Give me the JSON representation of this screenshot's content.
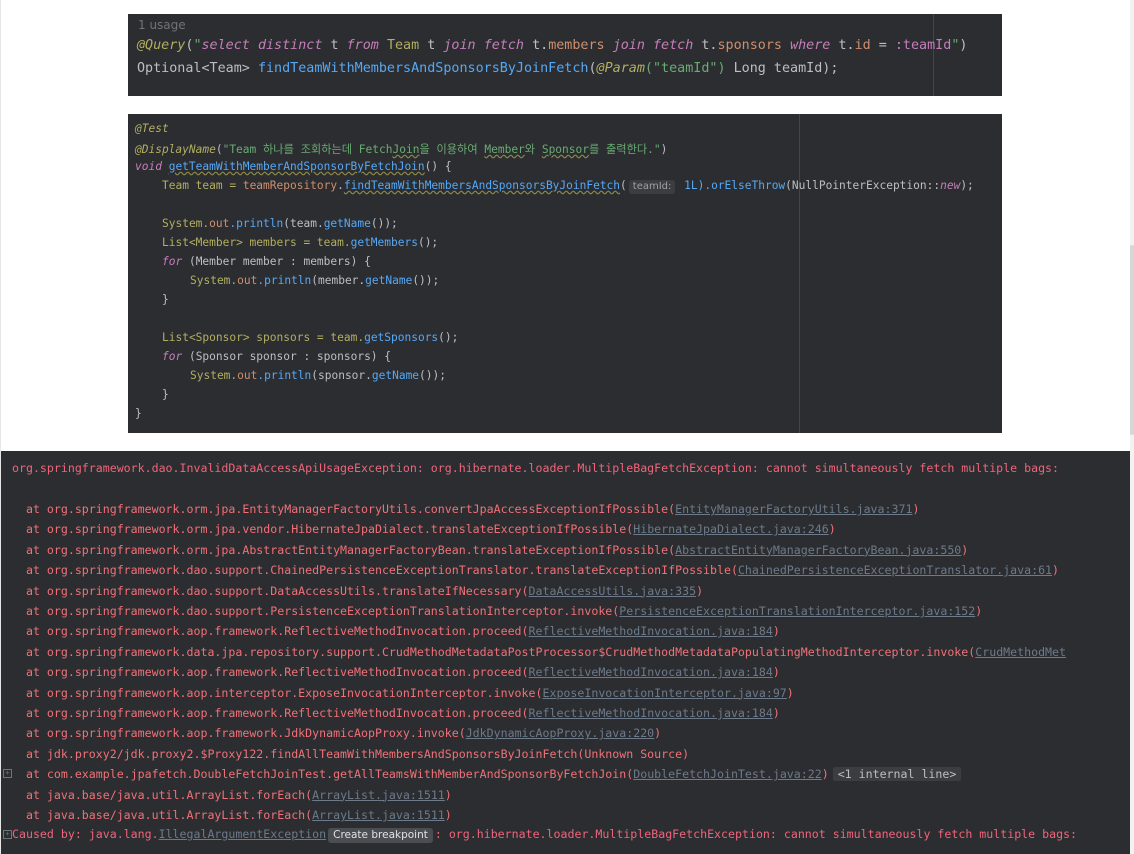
{
  "query_panel": {
    "usage": "1 usage",
    "line1": {
      "annotation": "@Query",
      "open": "(",
      "q_open": "\"",
      "q_select": "select",
      "q_distinct": "distinct",
      "q_t1": "t",
      "q_from": "from",
      "q_team": "Team",
      "q_t2": "t",
      "q_join1": "join",
      "q_fetch1": "fetch",
      "q_t3": "t.",
      "q_members": "members",
      "q_join2": "join",
      "q_fetch2": "fetch",
      "q_t4": "t.",
      "q_sponsors": "sponsors",
      "q_where": "where",
      "q_t5": "t.",
      "q_id": "id",
      "q_eq": "=",
      "q_param": ":teamId",
      "q_close": "\"",
      "close": ")"
    },
    "line2": {
      "type": "Optional<Team>",
      "method": "findTeamWithMembersAndSponsorsByJoinFetch",
      "open": "(",
      "param_ann": "@Param",
      "param_str": "(\"teamId\")",
      "param_type": "Long",
      "param_name": "teamId",
      "close": ");"
    }
  },
  "test_panel": {
    "l1": "@Test",
    "l2_ann": "@DisplayName",
    "l2_open": "(",
    "l2_str_a": "\"Team 하나를 조회하는데 Fetch",
    "l2_str_b": "Join",
    "l2_str_c": "을 이용하여 ",
    "l2_str_d": "Member",
    "l2_str_e": "와 ",
    "l2_str_f": "Sponsor",
    "l2_str_g": "를 출력한다.\"",
    "l2_close": ")",
    "l3_kw": "void",
    "l3_name": "getTeamWithMemberAndSponsorByFetchJoin",
    "l3_rest": "() {",
    "l4_type": "Team team = ",
    "l4_repo": "teamRepository",
    "l4_dot": ".",
    "l4_method": "findTeamWithMembersAndSponsorsByJoinFetch",
    "l4_open": "(",
    "l4_hint": "teamId:",
    "l4_arg": " 1L).",
    "l4_or": "orElseThrow",
    "l4_npe": "(NullPointerException::",
    "l4_new": "new",
    "l4_end": ");",
    "l6_sys": "System.",
    "l6_out": "out",
    "l6_print": ".println",
    "l6_arg": "(team.",
    "l6_get": "getName",
    "l6_end": "());",
    "l7_type": "List<Member> members = team.",
    "l7_get": "getMembers",
    "l7_end": "();",
    "l8_for": "for",
    "l8_rest": " (Member member : members) {",
    "l9_sys": "System.",
    "l9_out": "out",
    "l9_print": ".println",
    "l9_arg": "(member.",
    "l9_get": "getName",
    "l9_end": "());",
    "l10": "}",
    "l12_type": "List<Sponsor> sponsors = team.",
    "l12_get": "getSponsors",
    "l12_end": "();",
    "l13_for": "for",
    "l13_rest": " (Sponsor sponsor : sponsors) {",
    "l14_sys": "System.",
    "l14_out": "out",
    "l14_print": ".println",
    "l14_arg": "(sponsor.",
    "l14_get": "getName",
    "l14_end": "());",
    "l15": "}",
    "l16": "}"
  },
  "console": {
    "error_line": "org.springframework.dao.InvalidDataAccessApiUsageException: org.hibernate.loader.MultipleBagFetchException: cannot simultaneously fetch multiple bags:",
    "traces": [
      {
        "text": "  at org.springframework.orm.jpa.EntityManagerFactoryUtils.convertJpaAccessExceptionIfPossible(",
        "link": "EntityManagerFactoryUtils.java:371",
        "end": ")"
      },
      {
        "text": "  at org.springframework.orm.jpa.vendor.HibernateJpaDialect.translateExceptionIfPossible(",
        "link": "HibernateJpaDialect.java:246",
        "end": ")"
      },
      {
        "text": "  at org.springframework.orm.jpa.AbstractEntityManagerFactoryBean.translateExceptionIfPossible(",
        "link": "AbstractEntityManagerFactoryBean.java:550",
        "end": ")"
      },
      {
        "text": "  at org.springframework.dao.support.ChainedPersistenceExceptionTranslator.translateExceptionIfPossible(",
        "link": "ChainedPersistenceExceptionTranslator.java:61",
        "end": ")"
      },
      {
        "text": "  at org.springframework.dao.support.DataAccessUtils.translateIfNecessary(",
        "link": "DataAccessUtils.java:335",
        "end": ")"
      },
      {
        "text": "  at org.springframework.dao.support.PersistenceExceptionTranslationInterceptor.invoke(",
        "link": "PersistenceExceptionTranslationInterceptor.java:152",
        "end": ")"
      },
      {
        "text": "  at org.springframework.aop.framework.ReflectiveMethodInvocation.proceed(",
        "link": "ReflectiveMethodInvocation.java:184",
        "end": ")"
      },
      {
        "text": "  at org.springframework.data.jpa.repository.support.CrudMethodMetadataPostProcessor$CrudMethodMetadataPopulatingMethodInterceptor.invoke(",
        "link": "CrudMethodMet",
        "end": ""
      },
      {
        "text": "  at org.springframework.aop.framework.ReflectiveMethodInvocation.proceed(",
        "link": "ReflectiveMethodInvocation.java:184",
        "end": ")"
      },
      {
        "text": "  at org.springframework.aop.interceptor.ExposeInvocationInterceptor.invoke(",
        "link": "ExposeInvocationInterceptor.java:97",
        "end": ")"
      },
      {
        "text": "  at org.springframework.aop.framework.ReflectiveMethodInvocation.proceed(",
        "link": "ReflectiveMethodInvocation.java:184",
        "end": ")"
      },
      {
        "text": "  at org.springframework.aop.framework.JdkDynamicAopProxy.invoke(",
        "link": "JdkDynamicAopProxy.java:220",
        "end": ")"
      },
      {
        "text": "  at jdk.proxy2/jdk.proxy2.$Proxy122.findAllTeamWithMembersAndSponsorsByJoinFetch(Unknown Source)",
        "link": "",
        "end": ""
      },
      {
        "text": "  at com.example.jpafetch.DoubleFetchJoinTest.getAllTeamsWithMemberAndSponsorByFetchJoin(",
        "link": "DoubleFetchJoinTest.java:22",
        "end": ")"
      },
      {
        "text": "  at java.base/java.util.ArrayList.forEach(",
        "link": "ArrayList.java:1511",
        "end": ")"
      },
      {
        "text": "  at java.base/java.util.ArrayList.forEach(",
        "link": "ArrayList.java:1511",
        "end": ")"
      }
    ],
    "internal_line": "<1 internal line>",
    "caused_prefix": "Caused by: java.lang.",
    "caused_link": "IllegalArgumentException",
    "tooltip": "Create breakpoint",
    "caused_rest": ": org.hibernate.loader.MultipleBagFetchException: cannot simultaneously fetch multiple bags:",
    "expander_glyph": "+"
  }
}
